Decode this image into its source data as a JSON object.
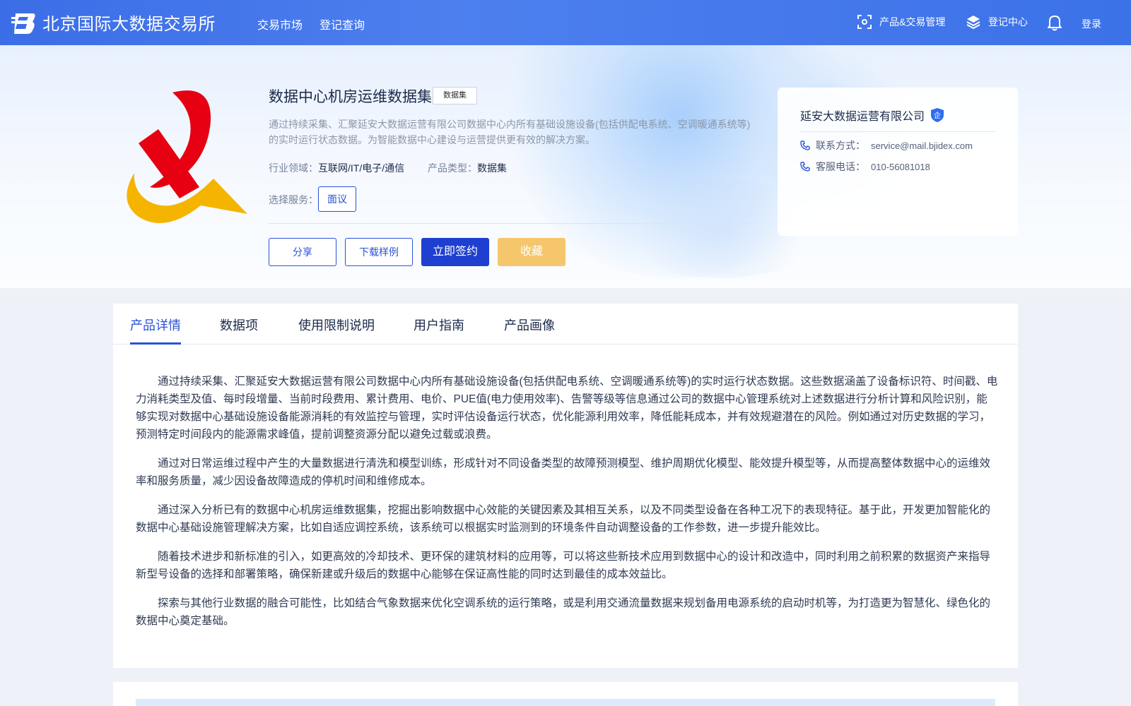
{
  "header": {
    "site_name": "北京国际大数据交易所",
    "nav": [
      "交易市场",
      "登记查询"
    ],
    "product_mgmt": "产品&交易管理",
    "register_center": "登记中心",
    "login": "登录"
  },
  "product": {
    "title": "数据中心机房运维数据集",
    "tag": "数据集",
    "description": "通过持续采集、汇聚延安大数据运营有限公司数据中心内所有基础设施设备(包括供配电系统、空调暖通系统等)的实时运行状态数据。为智能数据中心建设与运营提供更有效的解决方案。",
    "industry_label": "行业领域：",
    "industry_value": "互联网/IT/电子/通信",
    "type_label": "产品类型：",
    "type_value": "数据集",
    "service_label": "选择服务：",
    "service_option": "面议",
    "buttons": {
      "share": "分享",
      "download": "下载样例",
      "sign": "立即签约",
      "favorite": "收藏"
    }
  },
  "company": {
    "name": "延安大数据运营有限公司",
    "badge": "企",
    "contact_label": "联系方式：",
    "contact_value": "service@mail.bjidex.com",
    "phone_label": "客服电话：",
    "phone_value": "010-56081018"
  },
  "tabs": [
    "产品详情",
    "数据项",
    "使用限制说明",
    "用户指南",
    "产品画像"
  ],
  "active_tab": "产品详情",
  "details": [
    "通过持续采集、汇聚延安大数据运营有限公司数据中心内所有基础设施设备(包括供配电系统、空调暖通系统等)的实时运行状态数据。这些数据涵盖了设备标识符、时间戳、电力消耗类型及值、每时段增量、当前时段费用、累计费用、电价、PUE值(电力使用效率)、告警等级等信息通过公司的数据中心管理系统对上述数据进行分析计算和风险识别，能够实现对数据中心基础设施设备能源消耗的有效监控与管理，实时评估设备运行状态，优化能源利用效率，降低能耗成本，并有效规避潜在的风险。例如通过对历史数据的学习，预测特定时间段内的能源需求峰值，提前调整资源分配以避免过载或浪费。",
    "通过对日常运维过程中产生的大量数据进行清洗和模型训练，形成针对不同设备类型的故障预测模型、维护周期优化模型、能效提升模型等，从而提高整体数据中心的运维效率和服务质量，减少因设备故障造成的停机时间和维修成本。",
    "通过深入分析已有的数据中心机房运维数据集，挖掘出影响数据中心效能的关键因素及其相互关系，以及不同类型设备在各种工况下的表现特征。基于此，开发更加智能化的数据中心基础设施管理解决方案，比如自适应调控系统，该系统可以根据实时监测到的环境条件自动调整设备的工作参数，进一步提升能效比。",
    "随着技术进步和新标准的引入，如更高效的冷却技术、更环保的建筑材料的应用等，可以将这些新技术应用到数据中心的设计和改造中，同时利用之前积累的数据资产来指导新型号设备的选择和部署策略，确保新建或升级后的数据中心能够在保证高性能的同时达到最佳的成本效益比。",
    "探索与其他行业数据的融合可能性，比如结合气象数据来优化空调系统的运行策略，或是利用交通流量数据来规划备用电源系统的启动时机等，为打造更为智慧化、绿色化的数据中心奠定基础。"
  ],
  "colors": {
    "header_blue": "#3b6de6",
    "primary": "#1f3fd0",
    "accent_link": "#2a52d8",
    "favorite_yellow": "#f6c66c",
    "logo_red": "#e60012",
    "logo_yellow": "#f5b400"
  },
  "icons": [
    "brand-logo-icon",
    "scan-icon",
    "layers-icon",
    "bell-icon",
    "phone-icon",
    "enterprise-badge-icon"
  ]
}
